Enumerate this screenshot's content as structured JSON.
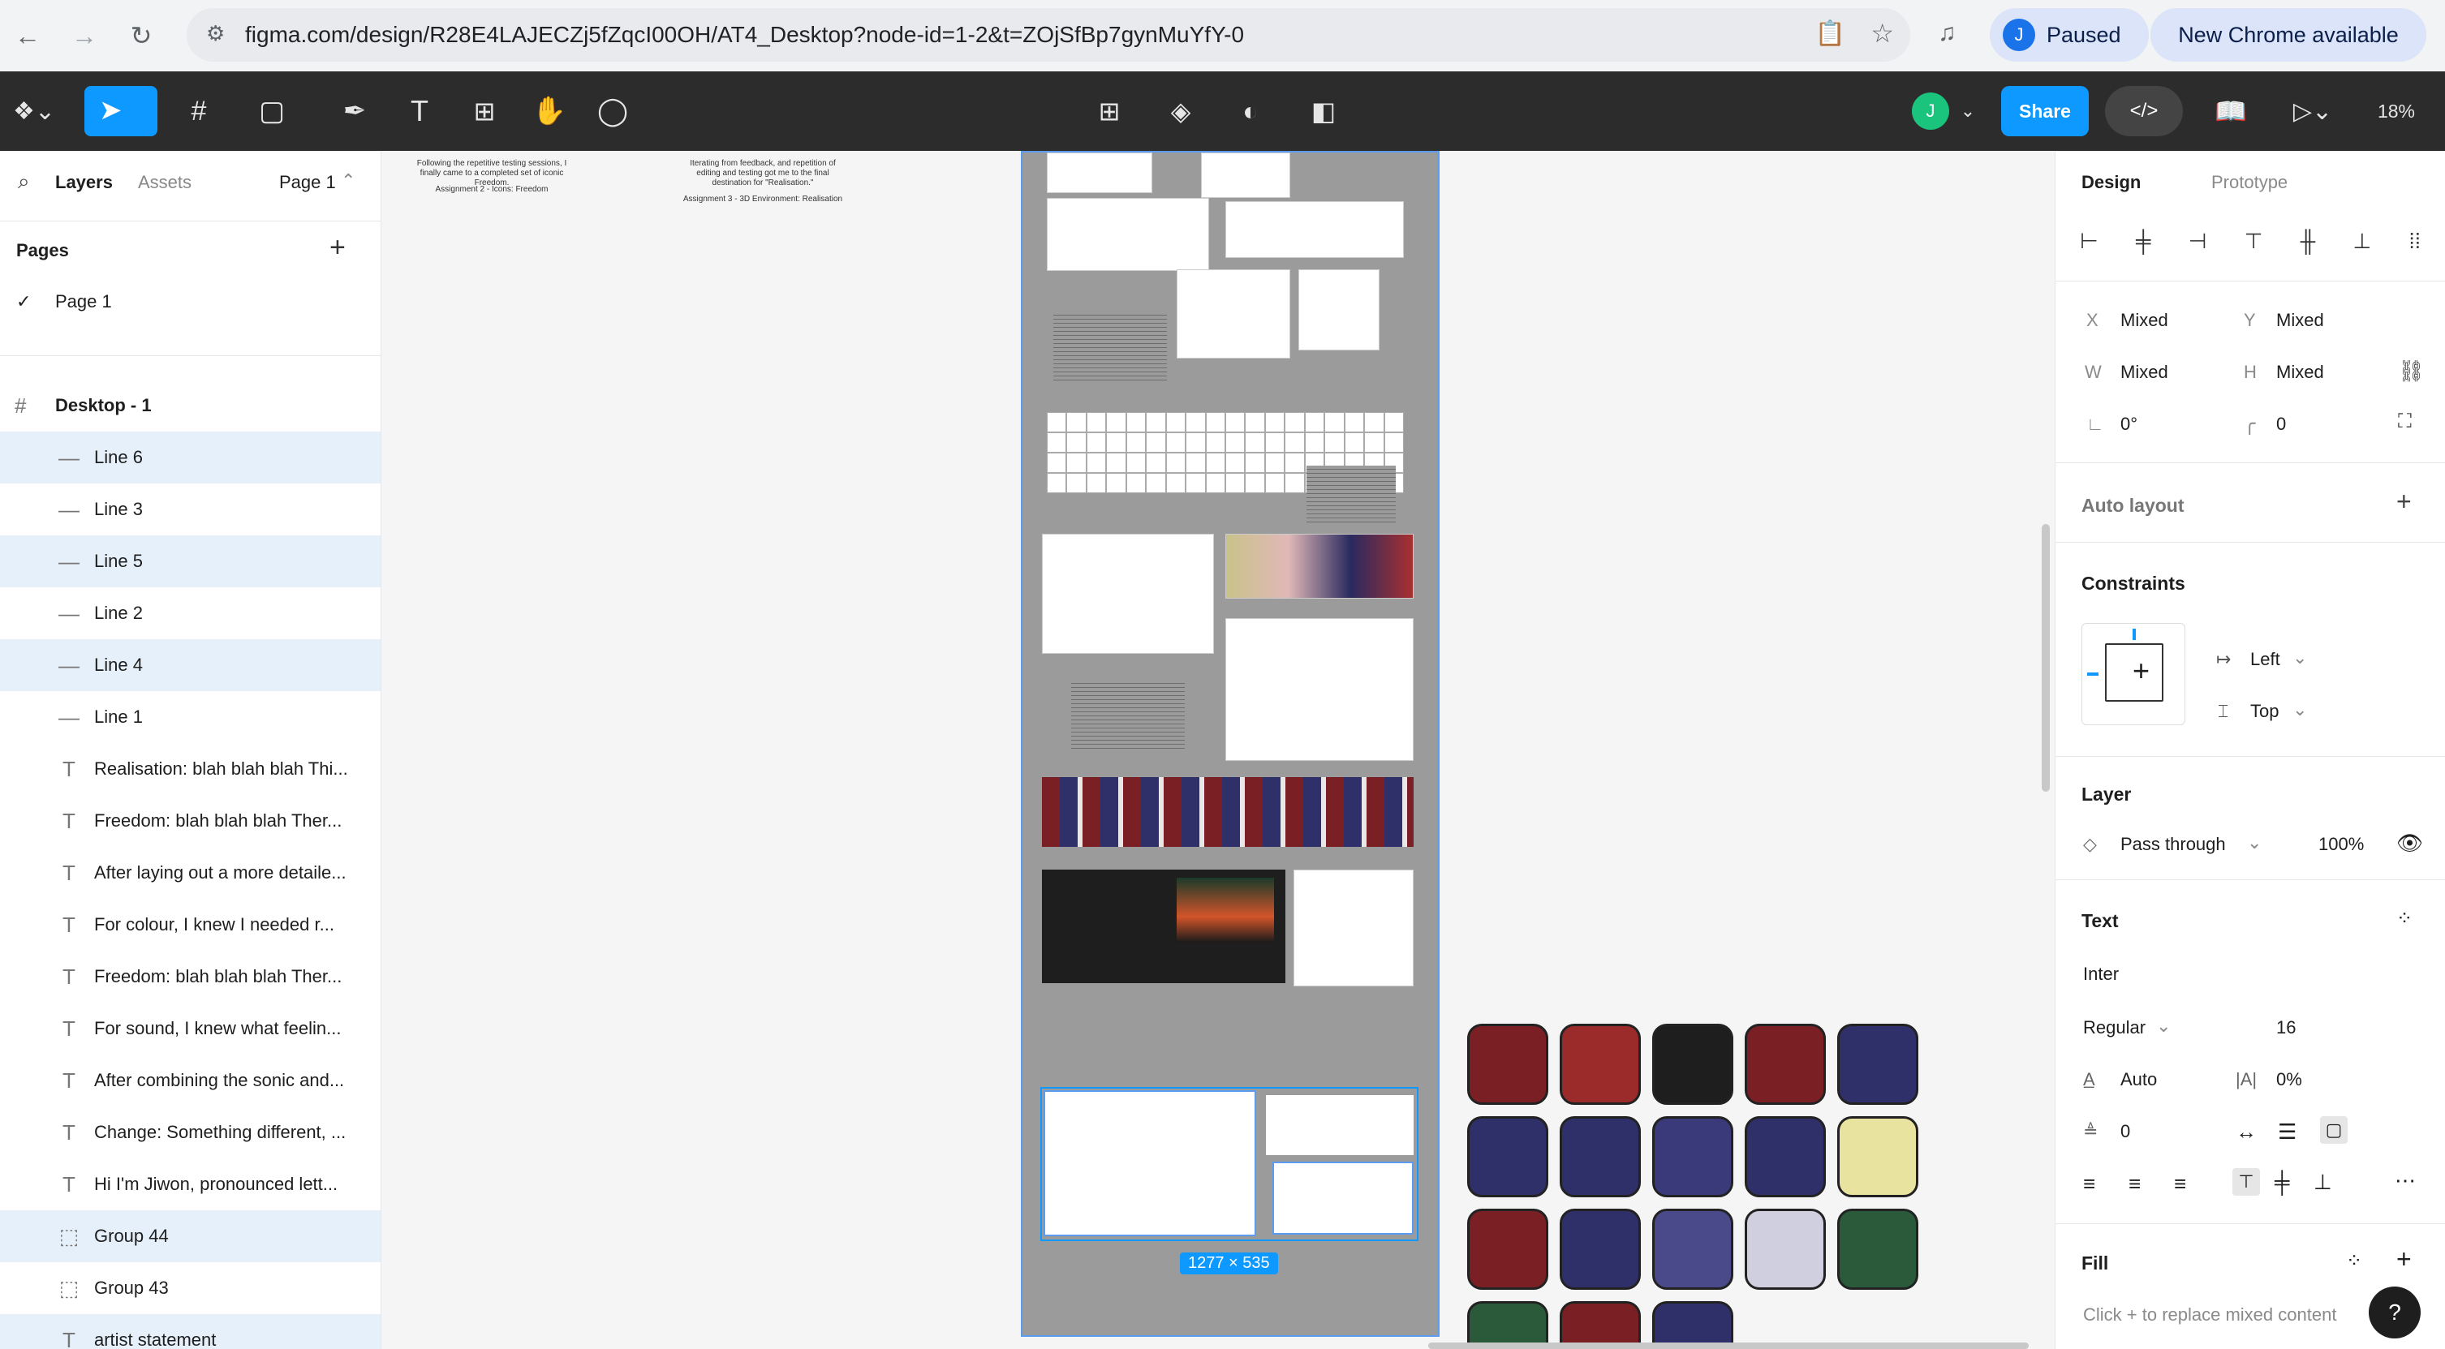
{
  "browser": {
    "url": "figma.com/design/R28E4LAJECZj5fZqcI00OH/AT4_Desktop?node-id=1-2&t=ZOjSfBp7gynMuYfY-0",
    "profile_initial": "J",
    "profile_status": "Paused",
    "update_label": "New Chrome available"
  },
  "toolbar": {
    "share_label": "Share",
    "avatar_initial": "J",
    "zoom": "18%",
    "accent": "#0d99ff"
  },
  "left_panel": {
    "tabs": [
      "Layers",
      "Assets"
    ],
    "page_selector": "Page 1",
    "pages_heading": "Pages",
    "pages": [
      "Page 1"
    ],
    "frame_name": "Desktop - 1",
    "layers": [
      {
        "icon": "line-icon",
        "label": "Line 6",
        "selected": true
      },
      {
        "icon": "line-icon",
        "label": "Line 3",
        "selected": false
      },
      {
        "icon": "line-icon",
        "label": "Line 5",
        "selected": true
      },
      {
        "icon": "line-icon",
        "label": "Line 2",
        "selected": false
      },
      {
        "icon": "line-icon",
        "label": "Line 4",
        "selected": true
      },
      {
        "icon": "line-icon",
        "label": "Line 1",
        "selected": false
      },
      {
        "icon": "text-icon",
        "label": "Realisation: blah blah blah Thi...",
        "selected": false
      },
      {
        "icon": "text-icon",
        "label": "Freedom: blah blah blah Ther...",
        "selected": false
      },
      {
        "icon": "text-icon",
        "label": "After laying out a more detaile...",
        "selected": false
      },
      {
        "icon": "text-icon",
        "label": "For colour, I knew I needed r...",
        "selected": false
      },
      {
        "icon": "text-icon",
        "label": "Freedom: blah blah blah Ther...",
        "selected": false
      },
      {
        "icon": "text-icon",
        "label": "For sound, I knew what feelin...",
        "selected": false
      },
      {
        "icon": "text-icon",
        "label": "After combining the sonic and...",
        "selected": false
      },
      {
        "icon": "text-icon",
        "label": "Change: Something different, ...",
        "selected": false
      },
      {
        "icon": "text-icon",
        "label": "Hi I'm Jiwon, pronounced lett...",
        "selected": false
      },
      {
        "icon": "group-icon",
        "label": "Group 44",
        "selected": true
      },
      {
        "icon": "group-icon",
        "label": "Group 43",
        "selected": false
      },
      {
        "icon": "text-icon",
        "label": "artist statement",
        "selected": true
      }
    ]
  },
  "canvas": {
    "caption_left_1": "Following the repetitive testing sessions, I finally came to a completed set of iconic Freedom.",
    "caption_left_2": "Assignment 2 - Icons: Freedom",
    "caption_right_1": "Iterating from feedback, and repetition of editing and testing got me to the final destination for \"Realisation.\"",
    "caption_right_2": "Assignment 3 - 3D Environment: Realisation",
    "selection_size": "1277 × 535"
  },
  "right_panel": {
    "tabs": [
      "Design",
      "Prototype"
    ],
    "x_label": "X",
    "x_value": "Mixed",
    "y_label": "Y",
    "y_value": "Mixed",
    "w_label": "W",
    "w_value": "Mixed",
    "h_label": "H",
    "h_value": "Mixed",
    "rotation": "0°",
    "radius": "0",
    "auto_layout": "Auto layout",
    "constraints": "Constraints",
    "constraint_h": "Left",
    "constraint_v": "Top",
    "layer": "Layer",
    "blend": "Pass through",
    "opacity": "100%",
    "text": "Text",
    "font": "Inter",
    "weight": "Regular",
    "size": "16",
    "line_height": "Auto",
    "letter_spacing": "0%",
    "paragraph": "0",
    "fill": "Fill",
    "fill_hint": "Click + to replace mixed content",
    "help": "?"
  }
}
